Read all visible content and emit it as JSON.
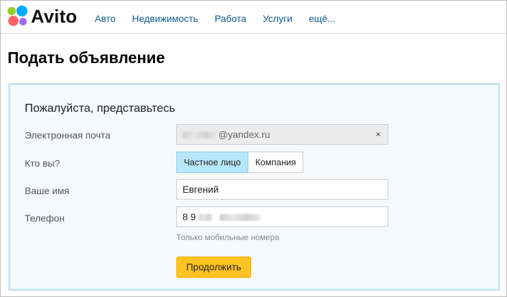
{
  "header": {
    "logo_text": "Avito",
    "nav": [
      "Авто",
      "Недвижимость",
      "Работа",
      "Услуги",
      "ещё..."
    ]
  },
  "page": {
    "title": "Подать объявление"
  },
  "form": {
    "title": "Пожалуйста, представьтесь",
    "email": {
      "label": "Электронная почта",
      "value_suffix": "@yandex.ru",
      "clear": "×"
    },
    "who": {
      "label": "Кто вы?",
      "options": [
        "Частное лицо",
        "Компания"
      ],
      "selected": "Частное лицо"
    },
    "name": {
      "label": "Ваше имя",
      "value": "Евгений"
    },
    "phone": {
      "label": "Телефон",
      "value_prefix": "8 9",
      "hint": "Только мобильные номера"
    },
    "submit": "Продолжить"
  },
  "colors": {
    "accent_link": "#0a5a93",
    "panel_bg": "#f5f9fc",
    "panel_border": "#c6e6f4",
    "submit_bg": "#ffc223",
    "selected_bg": "#b7e5fa"
  }
}
